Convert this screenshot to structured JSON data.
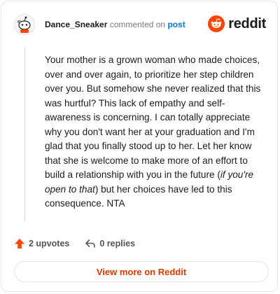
{
  "header": {
    "username": "Dance_Sneaker",
    "commented_text": " commented on ",
    "post_link": "post",
    "brand_name": "reddit"
  },
  "comment": {
    "part1": "Your mother is a grown woman who made choices, over and over again, to prioritize her step children over you. But somehow she never realized that this was hurtful? This lack of empathy and self-awareness is concerning. I can totally appreciate why you don't want her at your graduation and I'm glad that you finally stood up to her. Let her know that she is welcome to make more of an effort to build a relationship with you in the future (",
    "italic": "if you're open to that",
    "part2": ") but her choices have led to this consequence. NTA"
  },
  "actions": {
    "upvotes": "2 upvotes",
    "replies": "0 replies"
  },
  "footer": {
    "view_more": "View more on Reddit"
  },
  "icons": {
    "avatar": "snoo-avatar-icon",
    "brand": "reddit-logo-icon",
    "upvote": "upvote-arrow-icon",
    "reply": "reply-arrow-icon"
  },
  "colors": {
    "brand_orange": "#ff4500",
    "link_blue": "#0079d3",
    "view_more_text": "#d93900"
  }
}
